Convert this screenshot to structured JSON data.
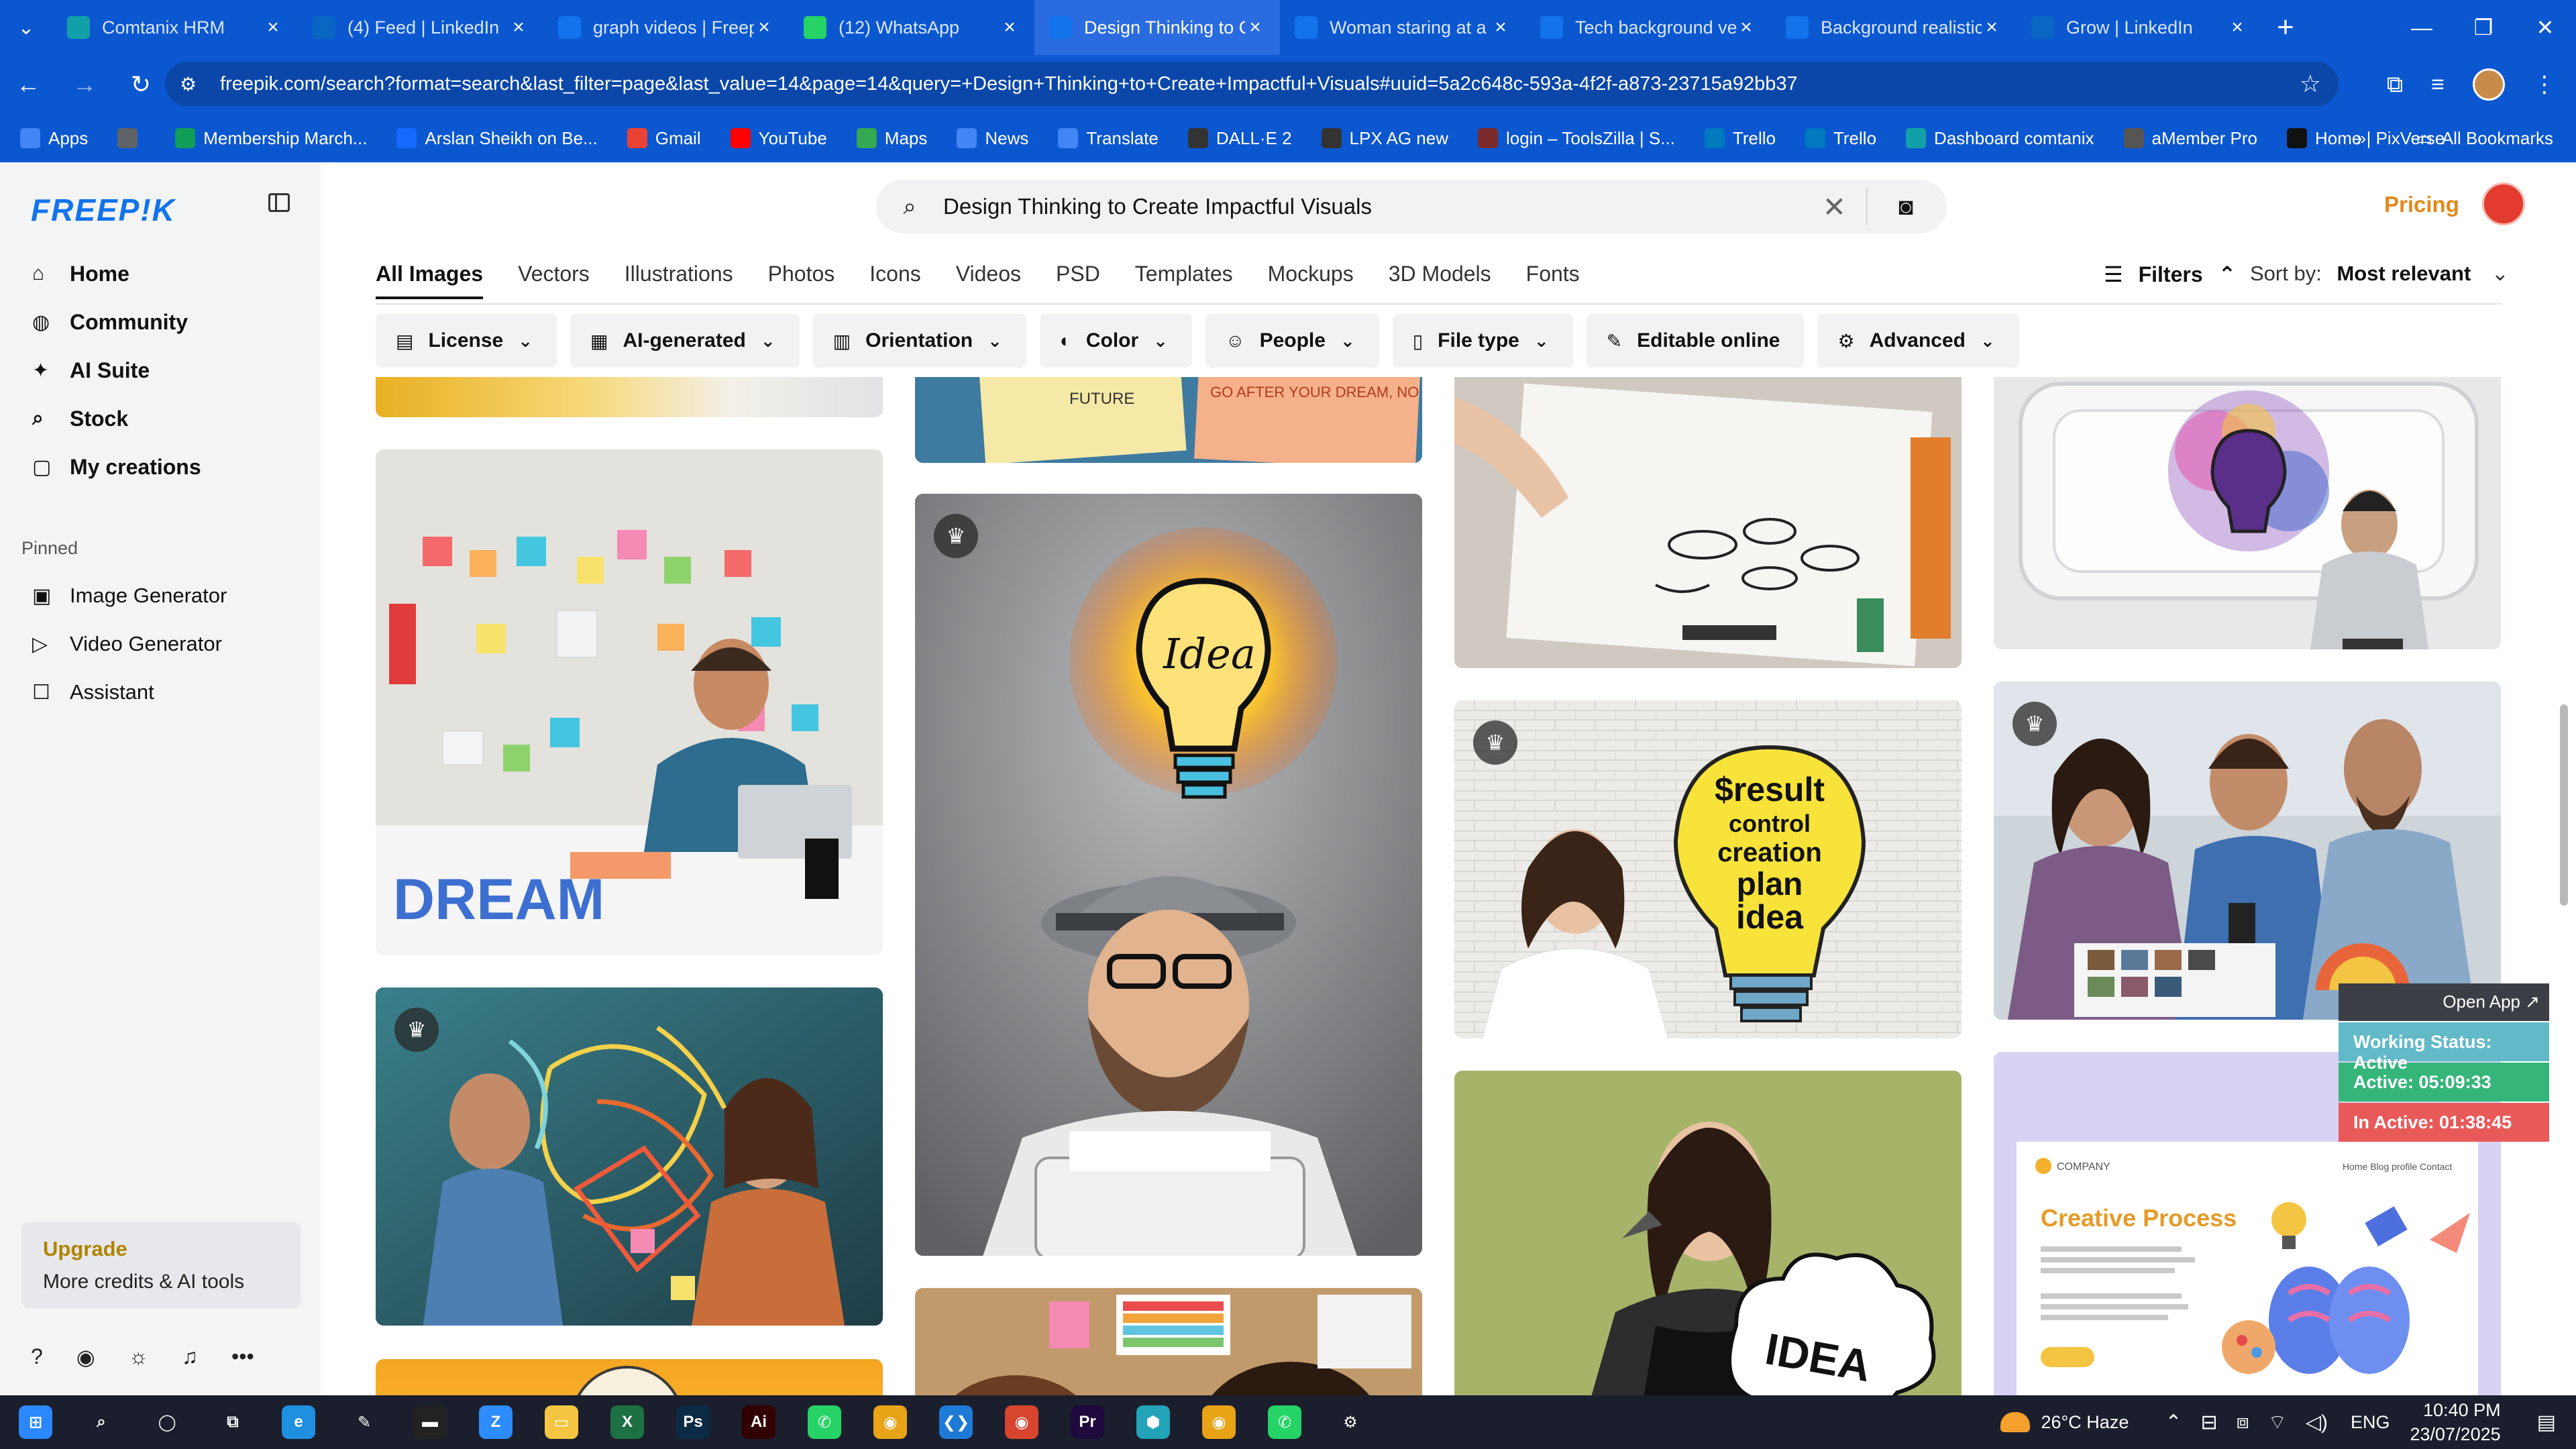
{
  "browser": {
    "tabs": [
      {
        "title": "Comtanix HRM",
        "icon": "comtanix-icon",
        "color": "#12a0a8"
      },
      {
        "title": "(4) Feed | LinkedIn",
        "icon": "linkedin-icon",
        "color": "#0a66c2"
      },
      {
        "title": "graph videos | Freep",
        "icon": "freepik-icon",
        "color": "#1273eb"
      },
      {
        "title": "(12) WhatsApp",
        "icon": "whatsapp-icon",
        "color": "#25d366"
      },
      {
        "title": "Design Thinking to C",
        "icon": "freepik-icon",
        "color": "#1273eb"
      },
      {
        "title": "Woman staring at a f",
        "icon": "freepik-icon",
        "color": "#1273eb"
      },
      {
        "title": "Tech background vec",
        "icon": "freepik-icon",
        "color": "#1273eb"
      },
      {
        "title": "Background realistic",
        "icon": "freepik-icon",
        "color": "#1273eb"
      },
      {
        "title": "Grow | LinkedIn",
        "icon": "linkedin-icon",
        "color": "#0a66c2"
      }
    ],
    "active_tab_index": 4,
    "url": "freepik.com/search?format=search&last_filter=page&last_value=14&page=14&query=+Design+Thinking+to+Create+Impactful+Visuals#uuid=5a2c648c-593a-4f2f-a873-23715a92bb37",
    "bookmarks": [
      {
        "label": "Apps",
        "color": "#4285f4"
      },
      {
        "label": "",
        "color": "#5f6368"
      },
      {
        "label": "Membership March...",
        "color": "#0f9d58"
      },
      {
        "label": "Arslan Sheikh on Be...",
        "color": "#1769ff"
      },
      {
        "label": "Gmail",
        "color": "#ea4335"
      },
      {
        "label": "YouTube",
        "color": "#ff0000"
      },
      {
        "label": "Maps",
        "color": "#34a853"
      },
      {
        "label": "News",
        "color": "#4285f4"
      },
      {
        "label": "Translate",
        "color": "#4285f4"
      },
      {
        "label": "DALL·E 2",
        "color": "#333333"
      },
      {
        "label": "LPX AG new",
        "color": "#333333"
      },
      {
        "label": "login – ToolsZilla | S...",
        "color": "#7b2b2b"
      },
      {
        "label": "Trello",
        "color": "#0079bf"
      },
      {
        "label": "Trello",
        "color": "#0079bf"
      },
      {
        "label": "Dashboard comtanix",
        "color": "#12a0a8"
      },
      {
        "label": "aMember Pro",
        "color": "#555555"
      },
      {
        "label": "Home | PixVerse",
        "color": "#111111"
      }
    ],
    "all_bookmarks": "All Bookmarks"
  },
  "sidebar": {
    "logo": "FREEP!K",
    "nav": [
      {
        "label": "Home",
        "icon": "home-icon",
        "glyph": "⌂"
      },
      {
        "label": "Community",
        "icon": "globe-icon",
        "glyph": "◍"
      },
      {
        "label": "AI Suite",
        "icon": "sparkle-icon",
        "glyph": "✦"
      },
      {
        "label": "Stock",
        "icon": "search-icon",
        "glyph": "⌕"
      },
      {
        "label": "My creations",
        "icon": "folder-icon",
        "glyph": "▢"
      }
    ],
    "pinned_title": "Pinned",
    "pinned": [
      {
        "label": "Image Generator",
        "icon": "image-icon",
        "glyph": "▣"
      },
      {
        "label": "Video Generator",
        "icon": "video-icon",
        "glyph": "▷"
      },
      {
        "label": "Assistant",
        "icon": "chat-icon",
        "glyph": "☐"
      }
    ],
    "upgrade": {
      "title": "Upgrade",
      "subtitle": "More credits & AI tools"
    }
  },
  "header": {
    "search_value": "Design Thinking to Create Impactful Visuals",
    "pricing": "Pricing",
    "categories": [
      "All Images",
      "Vectors",
      "Illustrations",
      "Photos",
      "Icons",
      "Videos",
      "PSD",
      "Templates",
      "Mockups",
      "3D Models",
      "Fonts"
    ],
    "active_category": 0,
    "filters": "Filters",
    "sort_label": "Sort by:",
    "sort_value": "Most relevant",
    "chips": [
      {
        "label": "License",
        "icon": "license-icon",
        "glyph": "▤"
      },
      {
        "label": "AI-generated",
        "icon": "ai-icon",
        "glyph": "▦"
      },
      {
        "label": "Orientation",
        "icon": "orientation-icon",
        "glyph": "▥"
      },
      {
        "label": "Color",
        "icon": "palette-icon",
        "glyph": "◐"
      },
      {
        "label": "People",
        "icon": "people-icon",
        "glyph": "☺"
      },
      {
        "label": "File type",
        "icon": "file-icon",
        "glyph": "▯"
      },
      {
        "label": "Editable online",
        "icon": "pen-icon",
        "glyph": "✎",
        "no_caret": true
      },
      {
        "label": "Advanced",
        "icon": "gear-icon",
        "glyph": "⚙"
      }
    ]
  },
  "grid": {
    "images": [
      {
        "name": "partial-top-yellow",
        "premium": false
      },
      {
        "name": "sticky-notes-future-dream",
        "premium": false
      },
      {
        "name": "hand-drawing-sketches",
        "premium": false
      },
      {
        "name": "man-looking-at-bulb-wall",
        "premium": false
      },
      {
        "name": "tired-man-post-it-wall",
        "premium": false
      },
      {
        "name": "hipster-typewriter-idea-bulb",
        "premium": true
      },
      {
        "name": "woman-result-bulb-wall",
        "premium": true
      },
      {
        "name": "team-reviewing-photos",
        "premium": true
      },
      {
        "name": "designers-drawing-on-glass",
        "premium": true
      },
      {
        "name": "woman-holding-idea-sign",
        "premium": false
      },
      {
        "name": "creative-process-landing-page",
        "premium": false
      },
      {
        "name": "orange-partial-bottom",
        "premium": false
      },
      {
        "name": "moodboard-color-palette",
        "premium": false
      }
    ],
    "result_texts": {
      "idea": "Idea",
      "result_lines": [
        "$result",
        "control",
        "creation",
        "plan",
        "idea"
      ],
      "sign": "IDEA",
      "dream": "DREAM",
      "landing_brand": "COMPANY",
      "landing_nav": "Home   Blog   profile   Contact",
      "landing_title": "Creative Process",
      "note_left": "FUTURE",
      "note_right": "GO AFTER YOUR DREAM, NO MATTER HOW UNATTAINABLE"
    }
  },
  "tracker": {
    "open_app": "Open App ↗",
    "status": "Working Status: Active",
    "active": "Active: 05:09:33",
    "inactive": "In Active: 01:38:45"
  },
  "taskbar": {
    "apps": [
      {
        "name": "windows-start",
        "color": "#2b88ff",
        "glyph": "⊞"
      },
      {
        "name": "search",
        "color": "#1b1e2c",
        "glyph": "⌕"
      },
      {
        "name": "cortana",
        "color": "#1b1e2c",
        "glyph": "◯"
      },
      {
        "name": "task-view",
        "color": "#1b1e2c",
        "glyph": "⧉"
      },
      {
        "name": "edge",
        "color": "#1f8fe0",
        "glyph": "e"
      },
      {
        "name": "pen-tool",
        "color": "#1b1e2c",
        "glyph": "✎"
      },
      {
        "name": "terminal",
        "color": "#222222",
        "glyph": "▬"
      },
      {
        "name": "zoom",
        "color": "#2d8cff",
        "glyph": "Z"
      },
      {
        "name": "file-explorer",
        "color": "#f4c542",
        "glyph": "▭"
      },
      {
        "name": "excel",
        "color": "#1d7044",
        "glyph": "X"
      },
      {
        "name": "photoshop",
        "color": "#0a2a45",
        "glyph": "Ps"
      },
      {
        "name": "illustrator",
        "color": "#330000",
        "glyph": "Ai"
      },
      {
        "name": "whatsapp",
        "color": "#25d366",
        "glyph": "✆"
      },
      {
        "name": "chrome",
        "color": "#e8a317",
        "glyph": "◉"
      },
      {
        "name": "vscode",
        "color": "#1e7ad6",
        "glyph": "❮❯"
      },
      {
        "name": "chrome-active",
        "color": "#d8452f",
        "glyph": "◉"
      },
      {
        "name": "premiere",
        "color": "#1f0a3d",
        "glyph": "Pr"
      },
      {
        "name": "app-hex",
        "color": "#22a3b8",
        "glyph": "⬢"
      },
      {
        "name": "chrome-2",
        "color": "#e8a317",
        "glyph": "◉"
      },
      {
        "name": "whatsapp-2",
        "color": "#25d366",
        "glyph": "✆"
      },
      {
        "name": "settings",
        "color": "#1b1e2c",
        "glyph": "⚙"
      }
    ],
    "weather": "26°C Haze",
    "lang": "ENG",
    "time": "10:40 PM",
    "date": "23/07/2025"
  }
}
